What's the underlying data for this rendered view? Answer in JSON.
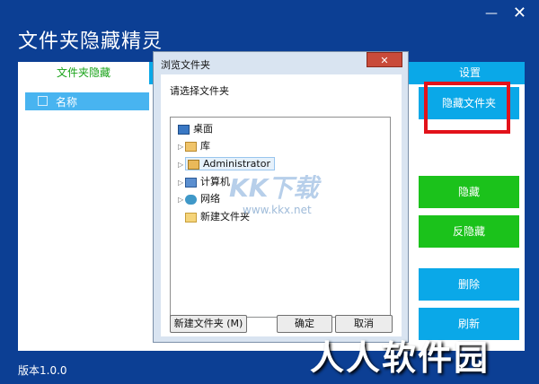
{
  "app": {
    "title": "文件夹隐藏精灵",
    "version": "版本1.0.0",
    "minimize_icon": "minimize-icon",
    "close_icon": "close-icon",
    "colors": {
      "background": "#0c3f94",
      "accent_blue": "#0aa8e8",
      "accent_green": "#1bc21b",
      "highlight": "#e2121a"
    }
  },
  "tabs": {
    "hide": "文件夹隐藏",
    "settings": "设置"
  },
  "list": {
    "header": "名称"
  },
  "actions": {
    "hide_folder": "隐藏文件夹",
    "hide": "隐藏",
    "unhide": "反隐藏",
    "delete": "删除",
    "refresh": "刷新"
  },
  "dialog": {
    "title": "浏览文件夹",
    "prompt": "请选择文件夹",
    "tree": [
      "桌面",
      "库",
      "Administrator",
      "计算机",
      "网络",
      "新建文件夹"
    ],
    "new_folder": "新建文件夹 (M)",
    "ok": "确定",
    "cancel": "取消"
  },
  "watermarks": {
    "kk": "KK下载",
    "kk_url": "www.kkx.net",
    "site": "人人软件园"
  }
}
